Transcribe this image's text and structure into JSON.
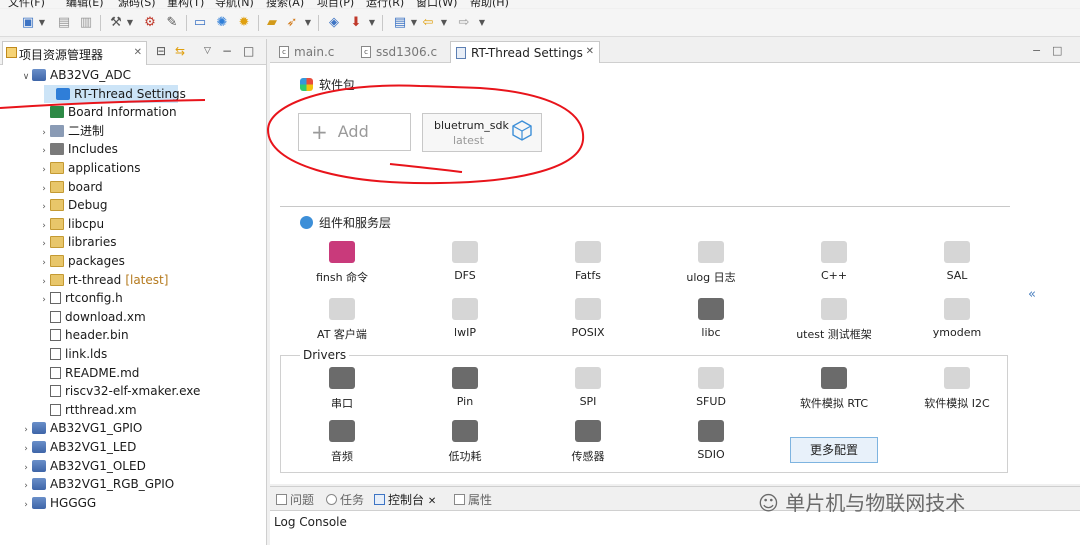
{
  "menubar": [
    "文件(F)",
    "编辑(E)",
    "源码(S)",
    "重构(T)",
    "导航(N)",
    "搜索(A)",
    "项目(P)",
    "运行(R)",
    "窗口(W)",
    "帮助(H)"
  ],
  "left_panel": {
    "tab_label": "项目资源管理器",
    "tree": [
      {
        "label": "AB32VG_ADC",
        "icon": "project",
        "depth": 0,
        "expanded": true
      },
      {
        "label": "RT-Thread Settings",
        "icon": "rt",
        "depth": 1,
        "selected": true
      },
      {
        "label": "Board Information",
        "icon": "board",
        "depth": 1
      },
      {
        "label": "二进制",
        "icon": "bin",
        "depth": 1,
        "expandable": true
      },
      {
        "label": "Includes",
        "icon": "inc",
        "depth": 1,
        "expandable": true
      },
      {
        "label": "applications",
        "icon": "folder",
        "depth": 1,
        "expandable": true
      },
      {
        "label": "board",
        "icon": "folder",
        "depth": 1,
        "expandable": true
      },
      {
        "label": "Debug",
        "icon": "folder",
        "depth": 1,
        "expandable": true
      },
      {
        "label": "libcpu",
        "icon": "folder",
        "depth": 1,
        "expandable": true
      },
      {
        "label": "libraries",
        "icon": "folder",
        "depth": 1,
        "expandable": true
      },
      {
        "label": "packages",
        "icon": "folder",
        "depth": 1,
        "expandable": true
      },
      {
        "label": "rt-thread",
        "tag": "[latest]",
        "icon": "folder",
        "depth": 1,
        "expandable": true
      },
      {
        "label": "rtconfig.h",
        "icon": "file",
        "depth": 1,
        "expandable": true
      },
      {
        "label": "download.xm",
        "icon": "file",
        "depth": 1
      },
      {
        "label": "header.bin",
        "icon": "file",
        "depth": 1
      },
      {
        "label": "link.lds",
        "icon": "file",
        "depth": 1
      },
      {
        "label": "README.md",
        "icon": "file",
        "depth": 1
      },
      {
        "label": "riscv32-elf-xmaker.exe",
        "icon": "file",
        "depth": 1
      },
      {
        "label": "rtthread.xm",
        "icon": "file",
        "depth": 1
      },
      {
        "label": "AB32VG1_GPIO",
        "icon": "project",
        "depth": 0,
        "expandable": true
      },
      {
        "label": "AB32VG1_LED",
        "icon": "project",
        "depth": 0,
        "expandable": true
      },
      {
        "label": "AB32VG1_OLED",
        "icon": "project",
        "depth": 0,
        "expandable": true
      },
      {
        "label": "AB32VG1_RGB_GPIO",
        "icon": "project",
        "depth": 0,
        "expandable": true
      },
      {
        "label": "HGGGG",
        "icon": "project",
        "depth": 0,
        "expandable": true
      }
    ]
  },
  "editor": {
    "tabs": [
      {
        "label": "main.c",
        "active": false
      },
      {
        "label": "ssd1306.c",
        "active": false
      },
      {
        "label": "RT-Thread Settings",
        "active": true
      }
    ],
    "packages_title": "软件包",
    "add_label": "Add",
    "package": {
      "name": "bluetrum_sdk",
      "version": "latest"
    },
    "components_title": "组件和服务层",
    "components": [
      {
        "label": "finsh 命令",
        "state": "pink"
      },
      {
        "label": "DFS",
        "state": "off"
      },
      {
        "label": "Fatfs",
        "state": "off"
      },
      {
        "label": "ulog 日志",
        "state": "off"
      },
      {
        "label": "C++",
        "state": "off"
      },
      {
        "label": "SAL",
        "state": "off"
      },
      {
        "label": "AT 客户端",
        "state": "off"
      },
      {
        "label": "lwIP",
        "state": "off"
      },
      {
        "label": "POSIX",
        "state": "off"
      },
      {
        "label": "libc",
        "state": "on"
      },
      {
        "label": "utest 测试框架",
        "state": "off"
      },
      {
        "label": "ymodem",
        "state": "off"
      }
    ],
    "drivers_title": "Drivers",
    "drivers": [
      {
        "label": "串口",
        "state": "on"
      },
      {
        "label": "Pin",
        "state": "on"
      },
      {
        "label": "SPI",
        "state": "off"
      },
      {
        "label": "SFUD",
        "state": "off"
      },
      {
        "label": "软件模拟 RTC",
        "state": "on"
      },
      {
        "label": "软件模拟 I2C",
        "state": "off"
      },
      {
        "label": "音频",
        "state": "on"
      },
      {
        "label": "低功耗",
        "state": "on"
      },
      {
        "label": "传感器",
        "state": "on"
      },
      {
        "label": "SDIO",
        "state": "on"
      }
    ],
    "more_button": "更多配置",
    "collapse": "«"
  },
  "bottom_panel": {
    "tabs": [
      {
        "label": "问题",
        "active": false
      },
      {
        "label": "任务",
        "active": false
      },
      {
        "label": "控制台",
        "active": true
      },
      {
        "label": "属性",
        "active": false
      }
    ],
    "console_title": "Log Console"
  },
  "watermark": "单片机与物联网技术",
  "colors": {
    "selection": "#cce4f7",
    "annotation": "#e8141b",
    "link": "#4a7fbf",
    "accent_pink": "#c93a7b"
  }
}
